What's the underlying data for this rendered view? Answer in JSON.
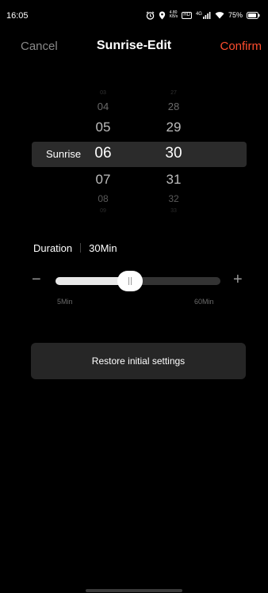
{
  "status_bar": {
    "time": "16:05",
    "net_speed_top": "4.80",
    "net_speed_bottom": "KB/s",
    "hd_badge": "HD",
    "signal_label": "4G",
    "battery": "75%"
  },
  "nav": {
    "cancel_label": "Cancel",
    "title": "Sunrise-Edit",
    "confirm_label": "Confirm",
    "confirm_color": "#ff4d2e"
  },
  "picker": {
    "row_label": "Sunrise",
    "hours": [
      "03",
      "04",
      "05",
      "06",
      "07",
      "08",
      "09"
    ],
    "minutes": [
      "27",
      "28",
      "29",
      "30",
      "31",
      "32",
      "33"
    ],
    "selected_hour": "06",
    "selected_minute": "30"
  },
  "duration": {
    "label": "Duration",
    "value": "30Min",
    "min_label": "5Min",
    "max_label": "60Min",
    "fraction": 0.45
  },
  "restore_label": "Restore initial settings"
}
